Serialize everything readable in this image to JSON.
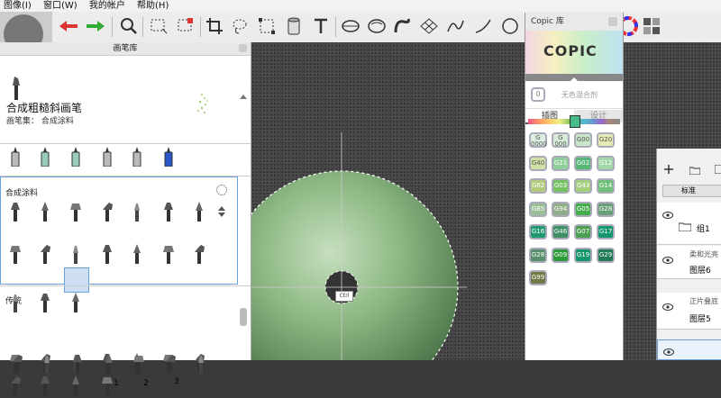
{
  "menu": {
    "items": [
      "图像(I)",
      "窗口(W)",
      "我的帐户",
      "帮助(H)"
    ]
  },
  "toolbar": {
    "icons": [
      "undo-arrow",
      "redo-arrow",
      "magnify",
      "rect-select",
      "rect-select-red",
      "crop",
      "lasso",
      "bucket",
      "symmetry",
      "text",
      "ellipse-guide",
      "french-curve",
      "perspective-grid",
      "stroke",
      "curve",
      "circle",
      "color-wheel",
      "palette-grid"
    ]
  },
  "brush_library": {
    "title": "画笔库",
    "current_brush": {
      "name": "合成粗糙斜画笔",
      "set": "画笔集： 合成涂料"
    },
    "sections": [
      {
        "title": "合成涂料"
      },
      {
        "title": "传统"
      }
    ],
    "traditional_numbers": [
      "1",
      "2",
      "3"
    ]
  },
  "canvas": {
    "selection_label": "Ctrl"
  },
  "copic": {
    "title": "Copic 库",
    "logo": "COPIC",
    "colorless_label": "无色混合剂",
    "colorless_code": "0",
    "tabs": [
      "插图",
      "设计"
    ],
    "swatches": [
      {
        "code": "G\n0000",
        "color": "#dbeee0"
      },
      {
        "code": "G\n000",
        "color": "#d5ecd9"
      },
      {
        "code": "G00",
        "color": "#c8e6c8"
      },
      {
        "code": "G20",
        "color": "#e6ebb5"
      },
      {
        "code": "G40",
        "color": "#cfe0a4"
      },
      {
        "code": "G21",
        "color": "#8fcf9a"
      },
      {
        "code": "G02",
        "color": "#55b775"
      },
      {
        "code": "G12",
        "color": "#9fd7a7"
      },
      {
        "code": "G82",
        "color": "#b3c97b"
      },
      {
        "code": "G03",
        "color": "#74c262"
      },
      {
        "code": "G43",
        "color": "#a4cf7d"
      },
      {
        "code": "G14",
        "color": "#6fc078"
      },
      {
        "code": "G85",
        "color": "#9abf98"
      },
      {
        "code": "G94",
        "color": "#8fae87"
      },
      {
        "code": "G05",
        "color": "#46ad4c"
      },
      {
        "code": "G28",
        "color": "#699e76"
      },
      {
        "code": "G16",
        "color": "#21996e"
      },
      {
        "code": "G46",
        "color": "#3f8f64"
      },
      {
        "code": "G07",
        "color": "#4c9e52"
      },
      {
        "code": "G17",
        "color": "#12966e"
      },
      {
        "code": "G28",
        "color": "#588f6d"
      },
      {
        "code": "G09",
        "color": "#2d9b3a"
      },
      {
        "code": "G19",
        "color": "#15956b"
      },
      {
        "code": "G29",
        "color": "#1f7a55"
      },
      {
        "code": "G99",
        "color": "#6f7a48"
      }
    ]
  },
  "layers": {
    "header_button": "标准",
    "rows": [
      {
        "name": "组1"
      },
      {
        "name": "柔和光亮"
      },
      {
        "name": "图层6"
      },
      {
        "name": "正片叠底"
      },
      {
        "name": "图层5"
      }
    ]
  }
}
